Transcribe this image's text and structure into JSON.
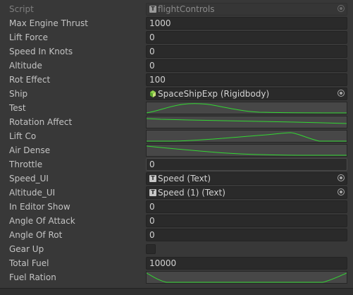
{
  "inspector": {
    "script": {
      "label": "Script",
      "value": "flightControls"
    },
    "max_engine_thrust": {
      "label": "Max Engine Thrust",
      "value": "1000"
    },
    "lift_force": {
      "label": "Lift Force",
      "value": "0"
    },
    "speed_in_knots": {
      "label": "Speed In Knots",
      "value": "0"
    },
    "altitude": {
      "label": "Altitude",
      "value": "0"
    },
    "rot_effect": {
      "label": "Rot Effect",
      "value": "100"
    },
    "ship": {
      "label": "Ship",
      "value": "SpaceShipExp (Rigidbody)",
      "icon": "gameobject-icon"
    },
    "test": {
      "label": "Test"
    },
    "rotation_affect": {
      "label": "Rotation Affect"
    },
    "lift_co": {
      "label": "Lift Co"
    },
    "air_dense": {
      "label": "Air Dense"
    },
    "throttle": {
      "label": "Throttle",
      "value": "0"
    },
    "speed_ui": {
      "label": "Speed_UI",
      "value": "Speed (Text)",
      "icon": "text-icon"
    },
    "altitude_ui": {
      "label": "Altitude_UI",
      "value": "Speed (1) (Text)",
      "icon": "text-icon"
    },
    "in_editor_show": {
      "label": "In Editor Show",
      "value": "0"
    },
    "angle_of_attack": {
      "label": "Angle Of Attack",
      "value": "0"
    },
    "angle_of_rot": {
      "label": "Angle Of Rot",
      "value": "0"
    },
    "gear_up": {
      "label": "Gear Up",
      "checked": false
    },
    "total_fuel": {
      "label": "Total Fuel",
      "value": "10000"
    },
    "fuel_ration": {
      "label": "Fuel Ration"
    }
  },
  "colors": {
    "background": "#383838",
    "field": "#2a2a2a",
    "curve_background": "#474747",
    "curve_line": "#33d633"
  }
}
